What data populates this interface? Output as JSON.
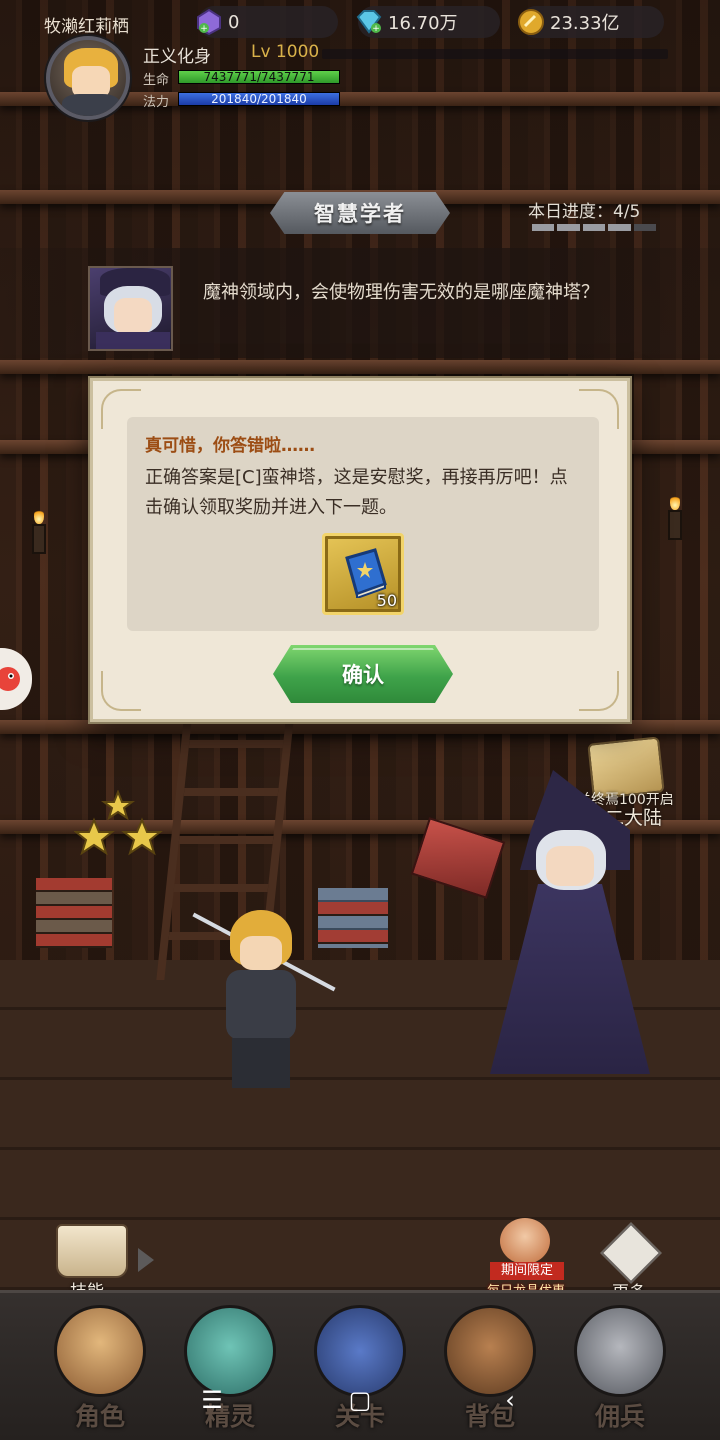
{
  "player": {
    "name": "牧濑红莉栖",
    "title": "正义化身",
    "level": "Lv 1000",
    "hp_label": "生命",
    "hp_value": "7437771/7437771",
    "hp_fraction": 1.0,
    "mp_label": "法力",
    "mp_value": "201840/201840",
    "mp_fraction": 1.0
  },
  "resources": {
    "gem": "0",
    "diamond": "16.70万",
    "gold": "23.33亿"
  },
  "quiz": {
    "title": "智慧学者",
    "progress_label": "本日进度：4/5",
    "progress_done": 4,
    "progress_total": 5,
    "question": "魔神领域内，会使物理伤害无效的是哪座魔神塔？"
  },
  "dialog": {
    "heading": "真可惜，你答错啦……",
    "body": "正确答案是[C]蛮神塔，这是安慰奖，再接再厉吧！点击确认领取奖励并进入下一题。",
    "reward_icon": "blue-book-icon",
    "reward_count": "50",
    "confirm_label": "确认"
  },
  "unlock_notice": {
    "line1": "通关终焉100开启",
    "line2": "第二大陆"
  },
  "shortcuts": {
    "skill_label": "技能",
    "promo_tag": "期间限定",
    "promo_label": "每日龙晶优惠",
    "more_label": "更多"
  },
  "bottom_nav": {
    "role": "角色",
    "spirit": "精灵",
    "battle": "关卡",
    "bag": "背包",
    "merc": "佣兵"
  },
  "system_nav": {
    "menu": "☰",
    "home": "▢",
    "back": "‹"
  },
  "colors": {
    "confirm_green": "#3fa34a",
    "heading_orange": "#9c4d14",
    "gold_level": "#d9b24a",
    "hp_green": "#2f9a2a",
    "mp_blue": "#1b3ca8"
  }
}
